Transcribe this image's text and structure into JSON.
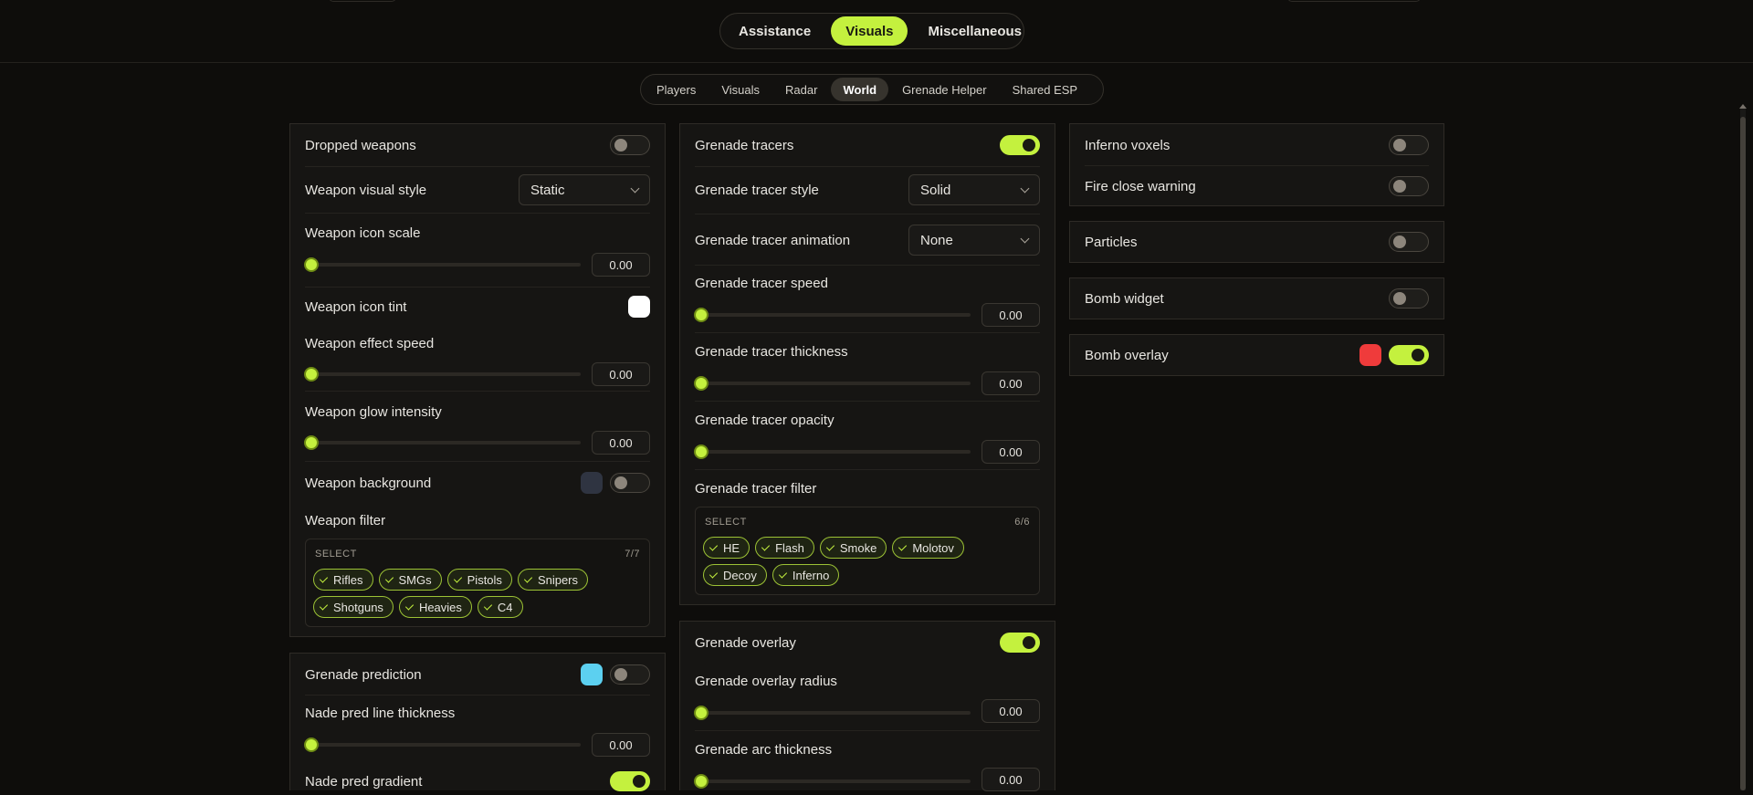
{
  "main_tabs": {
    "assistance": "Assistance",
    "visuals": "Visuals",
    "misc": "Miscellaneous"
  },
  "sub_tabs": {
    "players": "Players",
    "visuals": "Visuals",
    "radar": "Radar",
    "world": "World",
    "grenade_helper": "Grenade Helper",
    "shared_esp": "Shared ESP"
  },
  "colors": {
    "accent": "#c4f13e",
    "panel_bg": "#161513",
    "page_bg": "#0e0d0b",
    "weapon_icon_tint": "#ffffff",
    "weapon_background": "#2f3441",
    "grenade_prediction": "#5cd0f0",
    "bomb_overlay": "#ef3b3b"
  },
  "icons": {
    "dropdown": "chevron-down-icon",
    "chip": "check-icon"
  },
  "col1": {
    "dropped_weapons": {
      "label": "Dropped weapons",
      "on": false
    },
    "weapon_visual_style": {
      "label": "Weapon visual style",
      "value": "Static"
    },
    "weapon_icon_scale": {
      "label": "Weapon icon scale",
      "value": "0.00"
    },
    "weapon_icon_tint": {
      "label": "Weapon icon tint"
    },
    "weapon_effect_speed": {
      "label": "Weapon effect speed",
      "value": "0.00"
    },
    "weapon_glow_intensity": {
      "label": "Weapon glow intensity",
      "value": "0.00"
    },
    "weapon_background": {
      "label": "Weapon background",
      "on": false
    },
    "weapon_filter": {
      "label": "Weapon filter",
      "select": "SELECT",
      "count": "7/7",
      "chips": [
        "Rifles",
        "SMGs",
        "Pistols",
        "Snipers",
        "Shotguns",
        "Heavies",
        "C4"
      ]
    },
    "grenade_prediction": {
      "label": "Grenade prediction",
      "on": false
    },
    "nade_pred_line_thickness": {
      "label": "Nade pred line thickness",
      "value": "0.00"
    },
    "nade_pred_gradient": {
      "label": "Nade pred gradient",
      "on": true
    }
  },
  "col2": {
    "grenade_tracers": {
      "label": "Grenade tracers",
      "on": true
    },
    "grenade_tracer_style": {
      "label": "Grenade tracer style",
      "value": "Solid"
    },
    "grenade_tracer_animation": {
      "label": "Grenade tracer animation",
      "value": "None"
    },
    "grenade_tracer_speed": {
      "label": "Grenade tracer speed",
      "value": "0.00"
    },
    "grenade_tracer_thickness": {
      "label": "Grenade tracer thickness",
      "value": "0.00"
    },
    "grenade_tracer_opacity": {
      "label": "Grenade tracer opacity",
      "value": "0.00"
    },
    "grenade_tracer_filter": {
      "label": "Grenade tracer filter",
      "select": "SELECT",
      "count": "6/6",
      "chips": [
        "HE",
        "Flash",
        "Smoke",
        "Molotov",
        "Decoy",
        "Inferno"
      ]
    },
    "grenade_overlay": {
      "label": "Grenade overlay",
      "on": true
    },
    "grenade_overlay_radius": {
      "label": "Grenade overlay radius",
      "value": "0.00"
    },
    "grenade_arc_thickness": {
      "label": "Grenade arc thickness",
      "value": "0.00"
    }
  },
  "col3": {
    "inferno_voxels": {
      "label": "Inferno voxels",
      "on": false
    },
    "fire_close_warning": {
      "label": "Fire close warning",
      "on": false
    },
    "particles": {
      "label": "Particles",
      "on": false
    },
    "bomb_widget": {
      "label": "Bomb widget",
      "on": false
    },
    "bomb_overlay": {
      "label": "Bomb overlay",
      "on": true
    }
  }
}
